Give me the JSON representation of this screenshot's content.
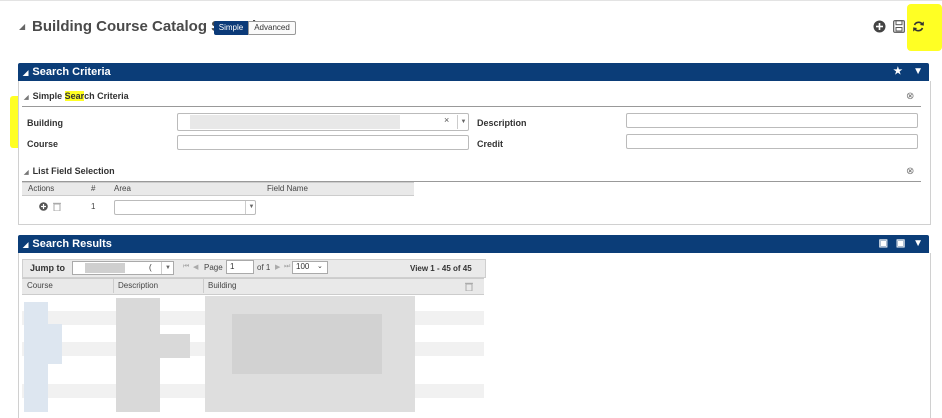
{
  "header": {
    "title": "Building Course Catalog Search",
    "mode_simple": "Simple",
    "mode_advanced": "Advanced",
    "icons": [
      "add-icon",
      "save-icon",
      "refresh-icon"
    ]
  },
  "search_criteria": {
    "title": "Search Criteria",
    "simple_section": {
      "title_before": "Simple ",
      "title_highlight": "Sear",
      "title_after": "ch Criteria"
    },
    "fields": {
      "building_label": "Building",
      "course_label": "Course",
      "description_label": "Description",
      "credit_label": "Credit"
    },
    "list_field_selection": {
      "title": "List Field Selection",
      "columns": [
        "Actions",
        "#",
        "Area",
        "Field Name"
      ],
      "row_number": "1"
    }
  },
  "search_results": {
    "title": "Search Results",
    "jump_to_label": "Jump to",
    "jump_to_value": "(",
    "page_label": "Page",
    "page_value": "1",
    "of_label": "of 1",
    "page_size": "100",
    "view_text": "View 1 - 45 of 45",
    "columns": [
      "Course",
      "Description",
      "Building"
    ]
  },
  "colors": {
    "panel_header": "#0b3d78",
    "highlight": "#ffff24",
    "simple_button": "#0b3a78"
  }
}
